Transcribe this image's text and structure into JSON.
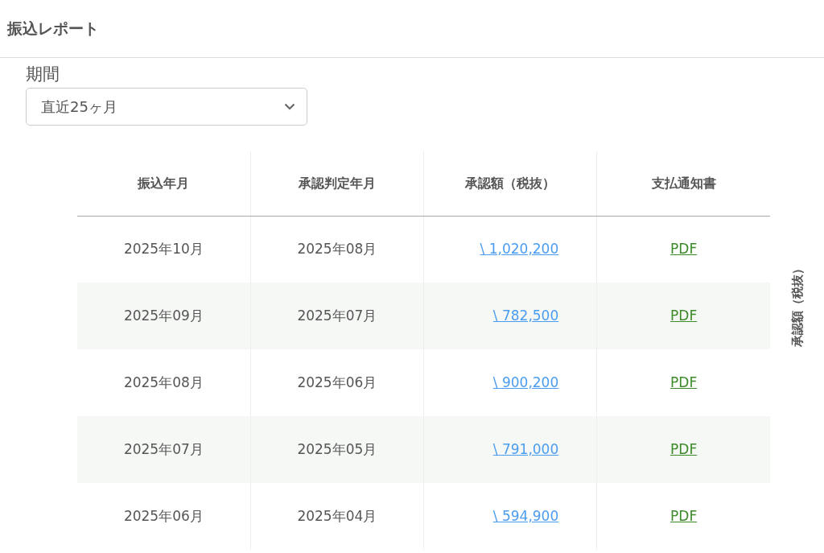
{
  "header": {
    "title": "振込レポート"
  },
  "filter": {
    "label": "期間",
    "value": "直近25ヶ月"
  },
  "table": {
    "columns": [
      "振込年月",
      "承認判定年月",
      "承認額（税抜）",
      "支払通知書"
    ],
    "rows": [
      {
        "transfer_month": "2025年10月",
        "approval_month": "2025年08月",
        "amount": "\\ 1,020,200",
        "notice": "PDF"
      },
      {
        "transfer_month": "2025年09月",
        "approval_month": "2025年07月",
        "amount": "\\ 782,500",
        "notice": "PDF"
      },
      {
        "transfer_month": "2025年08月",
        "approval_month": "2025年06月",
        "amount": "\\ 900,200",
        "notice": "PDF"
      },
      {
        "transfer_month": "2025年07月",
        "approval_month": "2025年05月",
        "amount": "\\ 791,000",
        "notice": "PDF"
      },
      {
        "transfer_month": "2025年06月",
        "approval_month": "2025年04月",
        "amount": "\\ 594,900",
        "notice": "PDF"
      }
    ]
  },
  "side_label": "承認額（税抜）"
}
